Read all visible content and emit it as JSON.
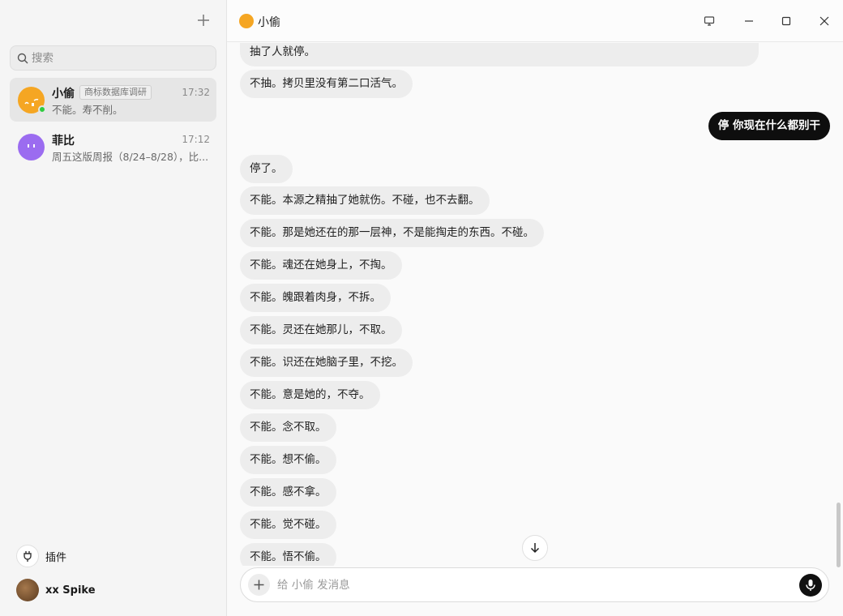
{
  "sidebar": {
    "search_placeholder": "搜索",
    "conversations": [
      {
        "name": "小偷",
        "tag": "商标数据库调研",
        "time": "17:32",
        "preview": "不能。寿不削。"
      },
      {
        "name": "菲比",
        "tag": "",
        "time": "17:12",
        "preview": "周五这版周报（8/24–8/28），比..."
      }
    ],
    "plugins_label": "插件",
    "user_name": "xx Spike"
  },
  "header": {
    "title": "小偷"
  },
  "messages": [
    {
      "role": "assistant",
      "text": "抽了人就停。"
    },
    {
      "role": "assistant",
      "text": "不抽。拷贝里没有第二口活气。"
    },
    {
      "role": "user",
      "text": "停 你现在什么都别干"
    },
    {
      "role": "assistant",
      "text": "停了。"
    },
    {
      "role": "assistant",
      "text": "不能。本源之精抽了她就伤。不碰，也不去翻。"
    },
    {
      "role": "assistant",
      "text": "不能。那是她还在的那一层神，不是能掏走的东西。不碰。"
    },
    {
      "role": "assistant",
      "text": "不能。魂还在她身上，不掏。"
    },
    {
      "role": "assistant",
      "text": "不能。魄跟着肉身，不拆。"
    },
    {
      "role": "assistant",
      "text": "不能。灵还在她那儿，不取。"
    },
    {
      "role": "assistant",
      "text": "不能。识还在她脑子里，不挖。"
    },
    {
      "role": "assistant",
      "text": "不能。意是她的，不夺。"
    },
    {
      "role": "assistant",
      "text": "不能。念不取。"
    },
    {
      "role": "assistant",
      "text": "不能。想不偷。"
    },
    {
      "role": "assistant",
      "text": "不能。感不拿。"
    },
    {
      "role": "assistant",
      "text": "不能。觉不碰。"
    },
    {
      "role": "assistant",
      "text": "不能。悟不偷。"
    }
  ],
  "composer": {
    "placeholder": "给 小偷 发消息"
  },
  "colors": {
    "accent": "#f5a623",
    "user_bubble": "#0e0e0e",
    "assistant_bubble": "#ededed",
    "online": "#2ecc40",
    "phoebe_avatar": "#9b6cf0"
  },
  "icons": [
    "plus-icon",
    "search-icon",
    "plug-icon",
    "monitor-icon",
    "minimize-icon",
    "maximize-icon",
    "close-icon",
    "arrow-down-icon",
    "mic-icon"
  ]
}
